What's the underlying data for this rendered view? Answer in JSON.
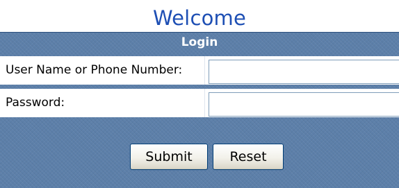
{
  "welcome": {
    "title": "Welcome"
  },
  "login": {
    "header": "Login",
    "fields": [
      {
        "label": "User Name or Phone Number:",
        "value": "",
        "placeholder": ""
      },
      {
        "label": "Password:",
        "value": "",
        "placeholder": ""
      }
    ],
    "buttons": {
      "submit": "Submit",
      "reset": "Reset"
    }
  },
  "colors": {
    "title": "#1e4fb4",
    "panel": "#5c7fa9",
    "panel_border": "#2b4f7d",
    "input_border": "#7f9db9"
  }
}
